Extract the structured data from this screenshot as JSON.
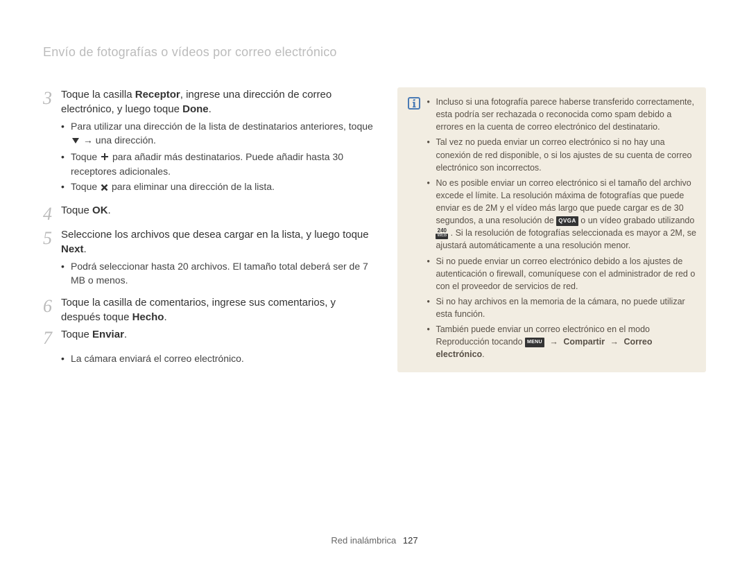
{
  "section_title": "Envío de fotografías o vídeos por correo electrónico",
  "steps": {
    "s3": {
      "num": "3",
      "text_before": "Toque la casilla ",
      "bold1": "Receptor",
      "text_mid": ", ingrese una dirección de correo electrónico, y luego toque ",
      "bold2": "Done",
      "text_after": ".",
      "bullets": {
        "b1_before": "Para utilizar una dirección de la lista de destinatarios anteriores, toque ",
        "b1_after": " → una dirección.",
        "b2_before": "Toque ",
        "b2_after": " para añadir más destinatarios. Puede añadir hasta 30 receptores adicionales.",
        "b3_before": "Toque ",
        "b3_after": " para eliminar una dirección de la lista."
      }
    },
    "s4": {
      "num": "4",
      "text_before": "Toque ",
      "bold": "OK",
      "text_after": "."
    },
    "s5": {
      "num": "5",
      "text_before": "Seleccione los archivos que desea cargar en la lista, y luego toque ",
      "bold": "Next",
      "text_after": ".",
      "bullets": {
        "b1": "Podrá seleccionar hasta 20 archivos. El tamaño total deberá ser de 7 MB o menos."
      }
    },
    "s6": {
      "num": "6",
      "text_before": "Toque la casilla de comentarios, ingrese sus comentarios, y después toque ",
      "bold": "Hecho",
      "text_after": "."
    },
    "s7": {
      "num": "7",
      "text_before": "Toque ",
      "bold": "Enviar",
      "text_after": ".",
      "bullets": {
        "b1": "La cámara enviará el correo electrónico."
      }
    }
  },
  "info": {
    "i1": "Incluso si una fotografía parece haberse transferido correctamente, esta podría ser rechazada o reconocida como spam debido a errores en la cuenta de correo electrónico del destinatario.",
    "i2": "Tal vez no pueda enviar un correo electrónico si no hay una conexión de red disponible, o si los ajustes de su cuenta de correo electrónico son incorrectos.",
    "i3_before": "No es posible enviar un correo electrónico si el tamaño del archivo excede el límite. La resolución máxima de fotografías que puede enviar es de 2M y el vídeo más largo que puede cargar es de 30 segundos, a una resolución de ",
    "i3_mid": " o un vídeo grabado utilizando ",
    "i3_after": ". Si la resolución de fotografías seleccionada es mayor a 2M, se ajustará automáticamente a una resolución menor.",
    "i4": "Si no puede enviar un correo electrónico debido a los ajustes de autenticación o firewall, comuníquese con el administrador de red o con el proveedor de servicios de red.",
    "i5": "Si no hay archivos en la memoria de la cámara, no puede utilizar esta función.",
    "i6_before": "También puede enviar un correo electrónico en el modo Reproducción tocando ",
    "i6_arrow1": " → ",
    "i6_b1": "Compartir",
    "i6_arrow2": " → ",
    "i6_b2": "Correo electrónico",
    "i6_after": "."
  },
  "badges": {
    "qvga": "QVGA",
    "video_top": "240",
    "video_bot": "WEB",
    "menu": "MENU"
  },
  "footer": {
    "label": "Red inalámbrica",
    "page": "127"
  }
}
